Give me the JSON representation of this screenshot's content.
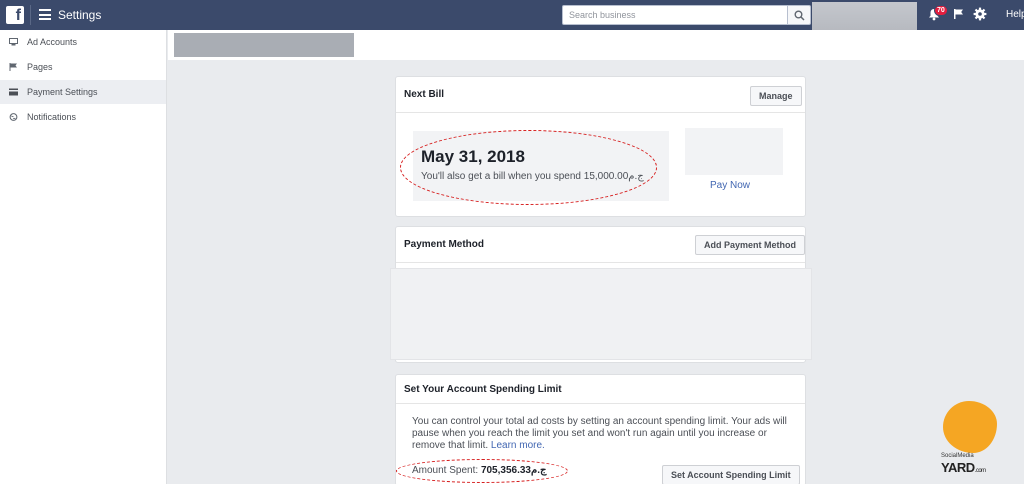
{
  "header": {
    "app_title": "Settings",
    "search_placeholder": "Search business",
    "notification_count": "70",
    "help_label": "Help"
  },
  "sidebar": {
    "items": [
      {
        "label": "Ad Accounts",
        "icon": "ad-accounts-icon"
      },
      {
        "label": "Pages",
        "icon": "flag-icon"
      },
      {
        "label": "Payment Settings",
        "icon": "card-icon",
        "active": true
      },
      {
        "label": "Notifications",
        "icon": "globe-icon"
      }
    ]
  },
  "next_bill": {
    "title": "Next Bill",
    "manage_label": "Manage",
    "date": "May 31, 2018",
    "note": "You'll also get a bill when you spend 15,000.00ج.م",
    "pay_now_label": "Pay Now"
  },
  "payment_method": {
    "title": "Payment Method",
    "add_label": "Add Payment Method"
  },
  "spending_limit": {
    "title": "Set Your Account Spending Limit",
    "description": "You can control your total ad costs by setting an account spending limit. Your ads will pause when you reach the limit you set and won't run again until you increase or remove that limit.",
    "learn_more": "Learn more.",
    "amount_label": "Amount Spent:",
    "amount_value": "705,356.33ج.م",
    "set_limit_label": "Set Account Spending Limit"
  },
  "watermark": {
    "small_text": "SocialMedia",
    "big_text": "YARD",
    "suffix": ".com"
  },
  "colors": {
    "topbar": "#3b4a6b",
    "link": "#4267b2",
    "badge": "#e41e3f",
    "annotation": "#d61c1c",
    "logo": "#f5a623"
  }
}
